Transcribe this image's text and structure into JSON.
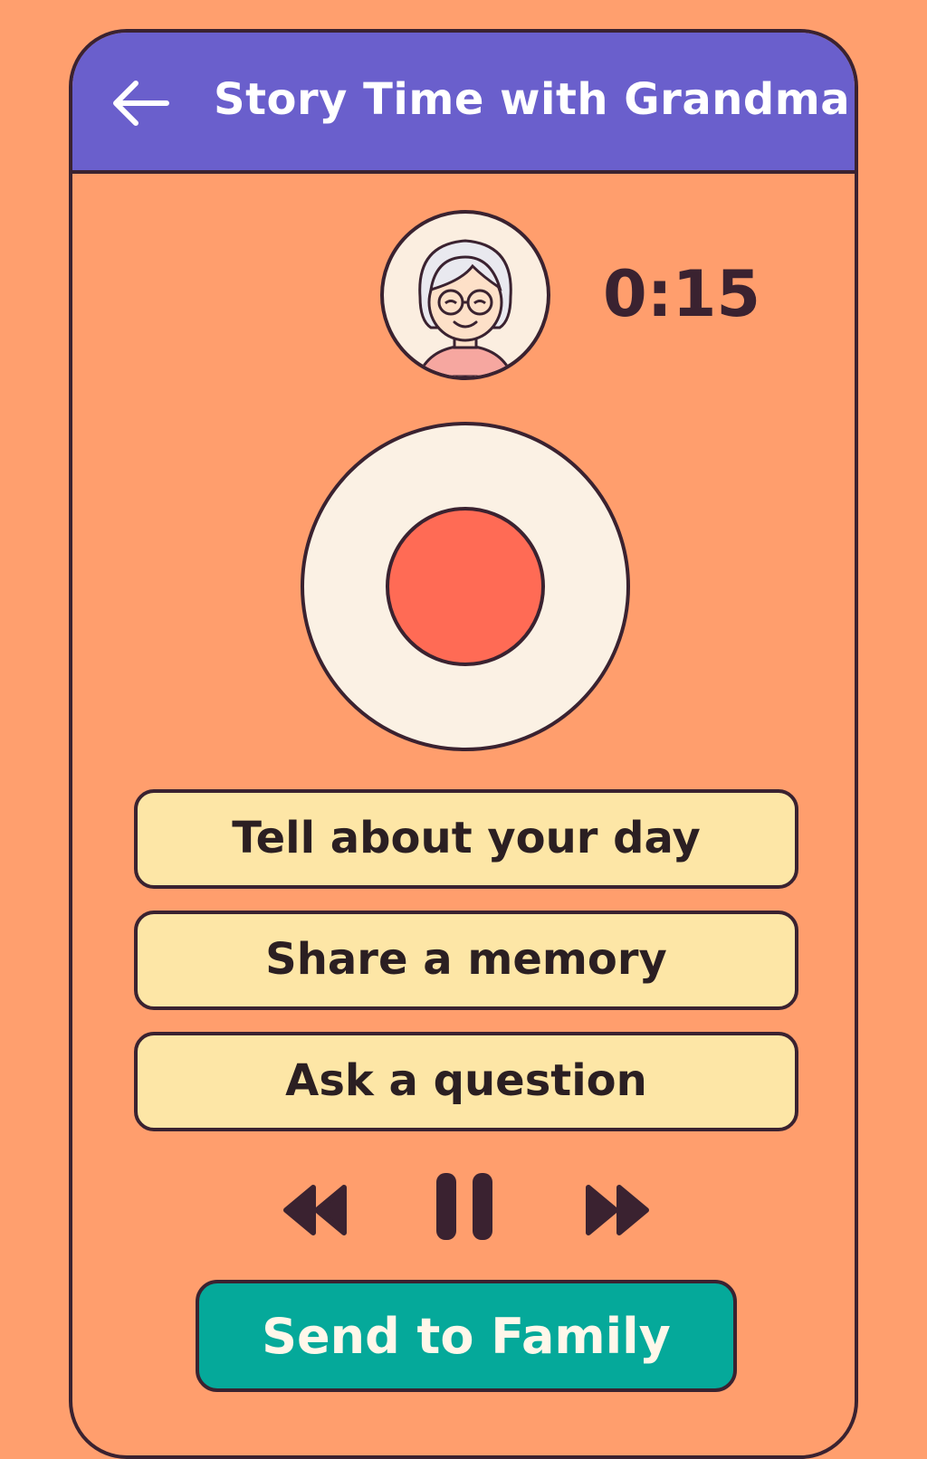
{
  "header": {
    "title": "Story Time with Grandma",
    "back_icon": "arrow-left-icon"
  },
  "recording": {
    "elapsed": "0:15",
    "avatar_icon": "grandma-avatar"
  },
  "prompts": [
    {
      "label": "Tell about your day"
    },
    {
      "label": "Share a memory"
    },
    {
      "label": "Ask a question"
    }
  ],
  "playback": {
    "rewind_icon": "rewind-icon",
    "pause_icon": "pause-icon",
    "forward_icon": "fast-forward-icon"
  },
  "actions": {
    "send_label": "Send to Family"
  },
  "colors": {
    "background": "#ff9f6e",
    "header": "#6a5fcc",
    "record": "#ff6b55",
    "prompt": "#fde6a6",
    "send": "#05a99a",
    "outline": "#3a2230"
  }
}
